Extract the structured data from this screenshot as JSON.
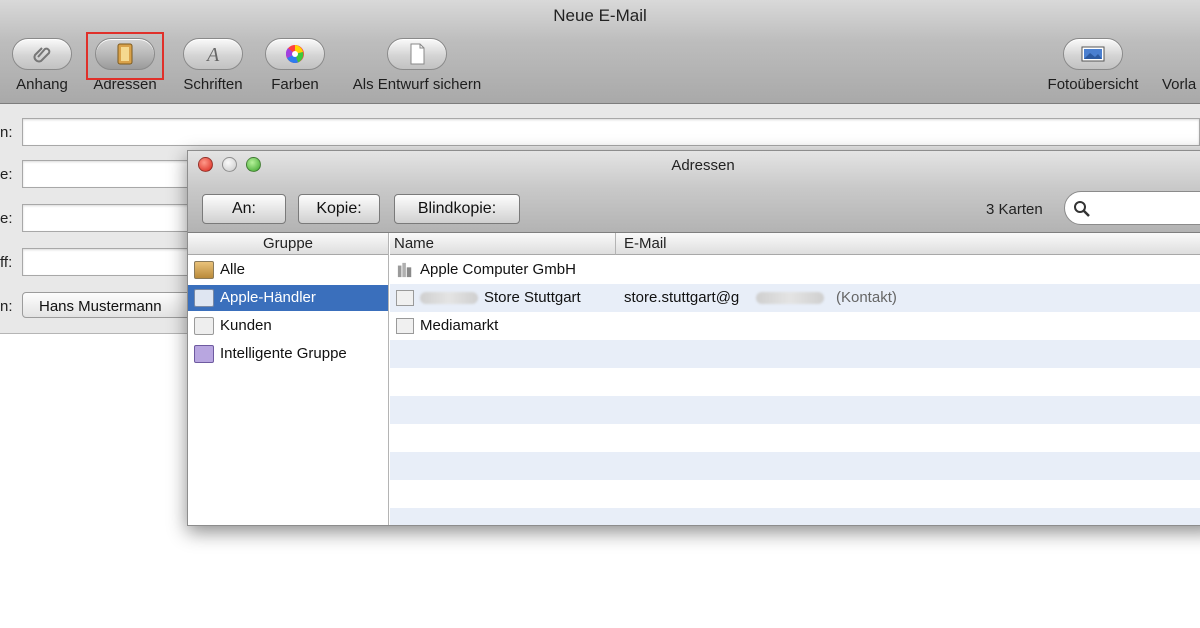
{
  "window": {
    "title": "Neue E-Mail"
  },
  "toolbar": {
    "items": [
      {
        "label": "Anhang",
        "icon": "paperclip-icon"
      },
      {
        "label": "Adressen",
        "icon": "address-book-icon"
      },
      {
        "label": "Schriften",
        "icon": "font-icon"
      },
      {
        "label": "Farben",
        "icon": "color-wheel-icon"
      },
      {
        "label": "Als Entwurf sichern",
        "icon": "draft-document-icon"
      },
      {
        "label": "Fotoübersicht",
        "icon": "photo-browser-icon"
      },
      {
        "label": "Vorla",
        "icon": "template-icon"
      }
    ],
    "highlight_color": "#e0302a"
  },
  "compose": {
    "fields": [
      {
        "label": "n:",
        "value": ""
      },
      {
        "label": "e:",
        "value": ""
      },
      {
        "label": "e:",
        "value": ""
      },
      {
        "label": "ff:",
        "value": ""
      },
      {
        "label": "n:",
        "value": "Hans Mustermann"
      }
    ]
  },
  "address_panel": {
    "title": "Adressen",
    "buttons": {
      "to": "An:",
      "cc": "Kopie:",
      "bcc": "Blindkopie:"
    },
    "card_count": "3 Karten",
    "search": {
      "placeholder": ""
    },
    "group_column": "Gruppe",
    "groups": [
      {
        "label": "Alle",
        "selected": false
      },
      {
        "label": "Apple-Händler",
        "selected": true
      },
      {
        "label": "Kunden",
        "selected": false
      },
      {
        "label": "Intelligente Gruppe",
        "selected": false
      }
    ],
    "columns": {
      "name": "Name",
      "email": "E-Mail"
    },
    "cards": [
      {
        "name": "Apple Computer GmbH",
        "email": "",
        "note": "",
        "icon": "company-icon"
      },
      {
        "name": "Store Stuttgart",
        "email": "store.stuttgart@g",
        "note": "(Kontakt)",
        "icon": "contact-card-icon"
      },
      {
        "name": "Mediamarkt",
        "email": "",
        "note": "",
        "icon": "contact-card-icon"
      }
    ],
    "selection_color": "#3a6fbc",
    "stripe_color": "#e8eef8"
  }
}
